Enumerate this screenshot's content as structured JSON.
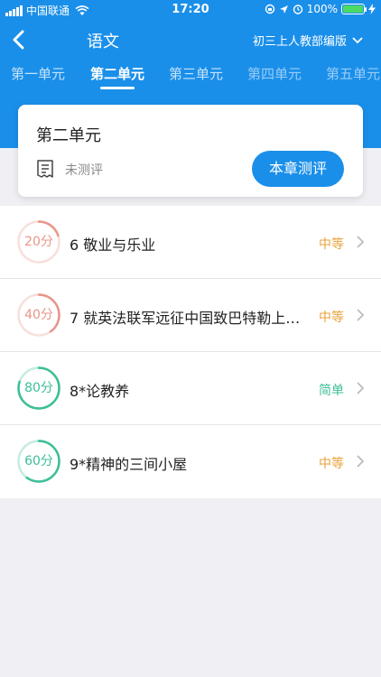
{
  "status_bar": {
    "carrier": "中国联通",
    "time": "17:20",
    "battery": "100%"
  },
  "nav": {
    "title": "语文",
    "edition": "初三上人教部编版"
  },
  "tabs": [
    "第一单元",
    "第二单元",
    "第三单元",
    "第四单元",
    "第五单元"
  ],
  "unit_card": {
    "title": "第二单元",
    "status": "未测评",
    "button": "本章测评"
  },
  "lessons": [
    {
      "score": "20分",
      "score_pct": 0.2,
      "title": "6 敬业与乐业",
      "difficulty": "中等",
      "color": "#e9958a",
      "diff_color": "#e9a23b"
    },
    {
      "score": "40分",
      "score_pct": 0.4,
      "title": "7 就英法联军远征中国致巴特勒上…",
      "difficulty": "中等",
      "color": "#e9958a",
      "diff_color": "#e9a23b"
    },
    {
      "score": "80分",
      "score_pct": 0.8,
      "title": "8*论教养",
      "difficulty": "简单",
      "color": "#3dbf98",
      "diff_color": "#3dbf98"
    },
    {
      "score": "60分",
      "score_pct": 0.6,
      "title": "9*精神的三间小屋",
      "difficulty": "中等",
      "color": "#3dbf98",
      "diff_color": "#e9a23b"
    }
  ],
  "colors": {
    "brand": "#1a8fea",
    "warn": "#e9a23b",
    "good": "#3dbf98",
    "low": "#e9958a"
  }
}
